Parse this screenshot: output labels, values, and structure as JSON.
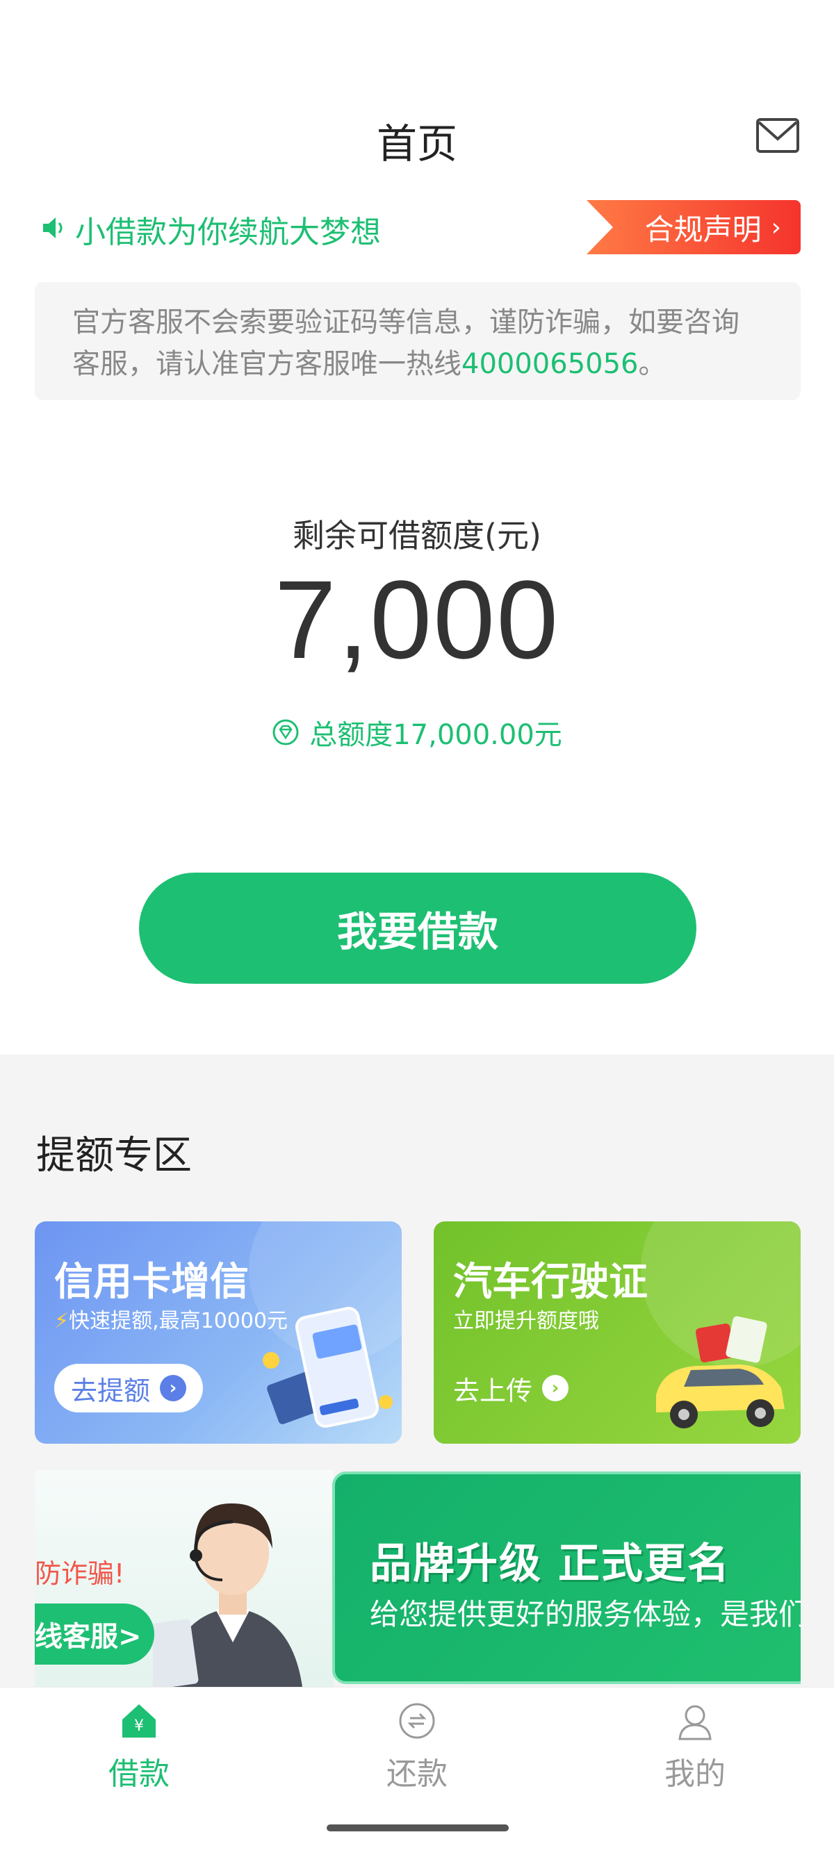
{
  "header": {
    "title": "首页",
    "mail_icon": "mail-icon"
  },
  "notice": {
    "slogan": "小借款为你续航大梦想",
    "compliance_label": "合规声明",
    "compliance_chevron": "›"
  },
  "warning": {
    "text_before": "官方客服不会索要验证码等信息，谨防诈骗，如要咨询客服，请认准官方客服唯一热线",
    "phone": "4000065056",
    "text_after": "。"
  },
  "quota": {
    "label": "剩余可借额度(元)",
    "value": "7,000",
    "total": "总额度17,000.00元"
  },
  "borrow_button": "我要借款",
  "boost": {
    "title": "提额专区",
    "cards": [
      {
        "title": "信用卡增信",
        "subtitle": "快速提额,最高10000元",
        "button": "去提额",
        "color": "#6d95f2"
      },
      {
        "title": "汽车行驶证",
        "subtitle": "立即提升额度哦",
        "button": "去上传",
        "color": "#8ccf35"
      }
    ]
  },
  "banner": {
    "anti_fraud": "防诈骗!",
    "cs_label": "线客服>",
    "headline": "品牌升级  正式更名",
    "body": "给您提供更好的服务体验，是我们"
  },
  "tabs": [
    {
      "label": "借款",
      "icon": "home-icon",
      "active": true
    },
    {
      "label": "还款",
      "icon": "repay-icon",
      "active": false
    },
    {
      "label": "我的",
      "icon": "user-icon",
      "active": false
    }
  ],
  "colors": {
    "accent": "#1dbf73",
    "danger": "#f5342d"
  }
}
